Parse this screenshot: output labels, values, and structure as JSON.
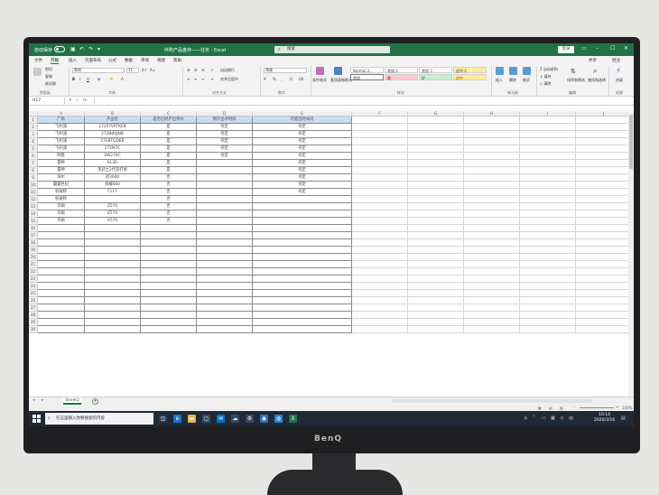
{
  "brand": {
    "logo": "BenQ"
  },
  "titlebar": {
    "autosave_label": "自动保存",
    "toggle_state": "关",
    "doc_title": "伴购产品盘存——任务 - Excel",
    "search_placeholder": "搜索",
    "login_label": "登录"
  },
  "tabs": [
    "文件",
    "开始",
    "插入",
    "页面布局",
    "公式",
    "数据",
    "审阅",
    "视图",
    "帮助"
  ],
  "active_tab": "开始",
  "share_label": "共享",
  "comment_label": "批注",
  "ribbon": {
    "clipboard": {
      "cut": "剪切",
      "copy": "复制",
      "format_painter": "格式刷",
      "label": "剪贴板"
    },
    "font": {
      "name": "等线",
      "size": "11",
      "label": "字体"
    },
    "alignment": {
      "wrap": "自动换行",
      "merge": "合并后居中",
      "label": "对齐方式"
    },
    "number": {
      "format": "常规",
      "label": "数字"
    },
    "styles": {
      "conditional": "条件格式",
      "table": "套用表格格式",
      "cells": [
        {
          "text": "Normal 2...",
          "bg": "#ffffff"
        },
        {
          "text": "常规 2",
          "bg": "#ffffff"
        },
        {
          "text": "常规 3",
          "bg": "#ffffff"
        },
        {
          "text": "适中 2",
          "bg": "#ffeb9c"
        },
        {
          "text": "常规",
          "bg": "#ffffff"
        },
        {
          "text": "差",
          "bg": "#ffc7ce"
        },
        {
          "text": "好",
          "bg": "#c6efce"
        },
        {
          "text": "适中",
          "bg": "#ffeb9c"
        }
      ],
      "label": "样式"
    },
    "cells": {
      "insert": "插入",
      "delete": "删除",
      "format": "格式",
      "label": "单元格"
    },
    "editing": {
      "autosum": "自动求和",
      "fill": "填充",
      "clear": "清除",
      "sort": "排序和筛选",
      "find": "查找和选择",
      "label": "编辑"
    },
    "ideas": {
      "label": "创意"
    }
  },
  "formula_bar": {
    "cell_ref": "H17",
    "fx": "fx"
  },
  "columns": [
    "A",
    "B",
    "C",
    "D",
    "E",
    "F",
    "G",
    "H",
    "I",
    "J"
  ],
  "table": {
    "headers": [
      "厂商",
      "产品名",
      "是否已经产出评价",
      "预计出评时间",
      "可提出时间问"
    ],
    "rows": [
      [
        "飞利浦",
        "272P7VPTKEB",
        "是",
        "待定",
        "待定"
      ],
      [
        "飞利浦",
        "272B8QJNB",
        "是",
        "待定",
        "待定"
      ],
      [
        "飞利浦",
        "27E8TQDEB",
        "是",
        "待定",
        "待定"
      ],
      [
        "飞利浦",
        "272M7C",
        "是",
        "待定",
        "待定"
      ],
      [
        "明基",
        "SW270C",
        "是",
        "待定",
        "待定"
      ],
      [
        "雷神",
        "KL30",
        "是",
        "",
        "待定"
      ],
      [
        "雷神",
        "黑武士2代双打修",
        "是",
        "",
        "待定"
      ],
      [
        "海尔",
        "拯3000",
        "否",
        "",
        "待定"
      ],
      [
        "霸霸世纪",
        "侠耀S60",
        "否",
        "",
        "待定"
      ],
      [
        "机械师",
        "F117",
        "否",
        "",
        "待定"
      ],
      [
        "机械师",
        "",
        "否",
        "",
        ""
      ],
      [
        "华硕",
        "Z570",
        "否",
        "",
        ""
      ],
      [
        "华硕",
        "Z570",
        "否",
        "",
        ""
      ],
      [
        "华硕",
        "X570",
        "否",
        "",
        ""
      ]
    ],
    "total_rows": 30
  },
  "sheet": {
    "name": "Sheet2",
    "add": "+"
  },
  "status": {
    "zoom": "100%"
  },
  "taskbar": {
    "search_placeholder": "在这里输入你要搜索的内容",
    "time": "10:14",
    "date": "2020/3/16"
  }
}
